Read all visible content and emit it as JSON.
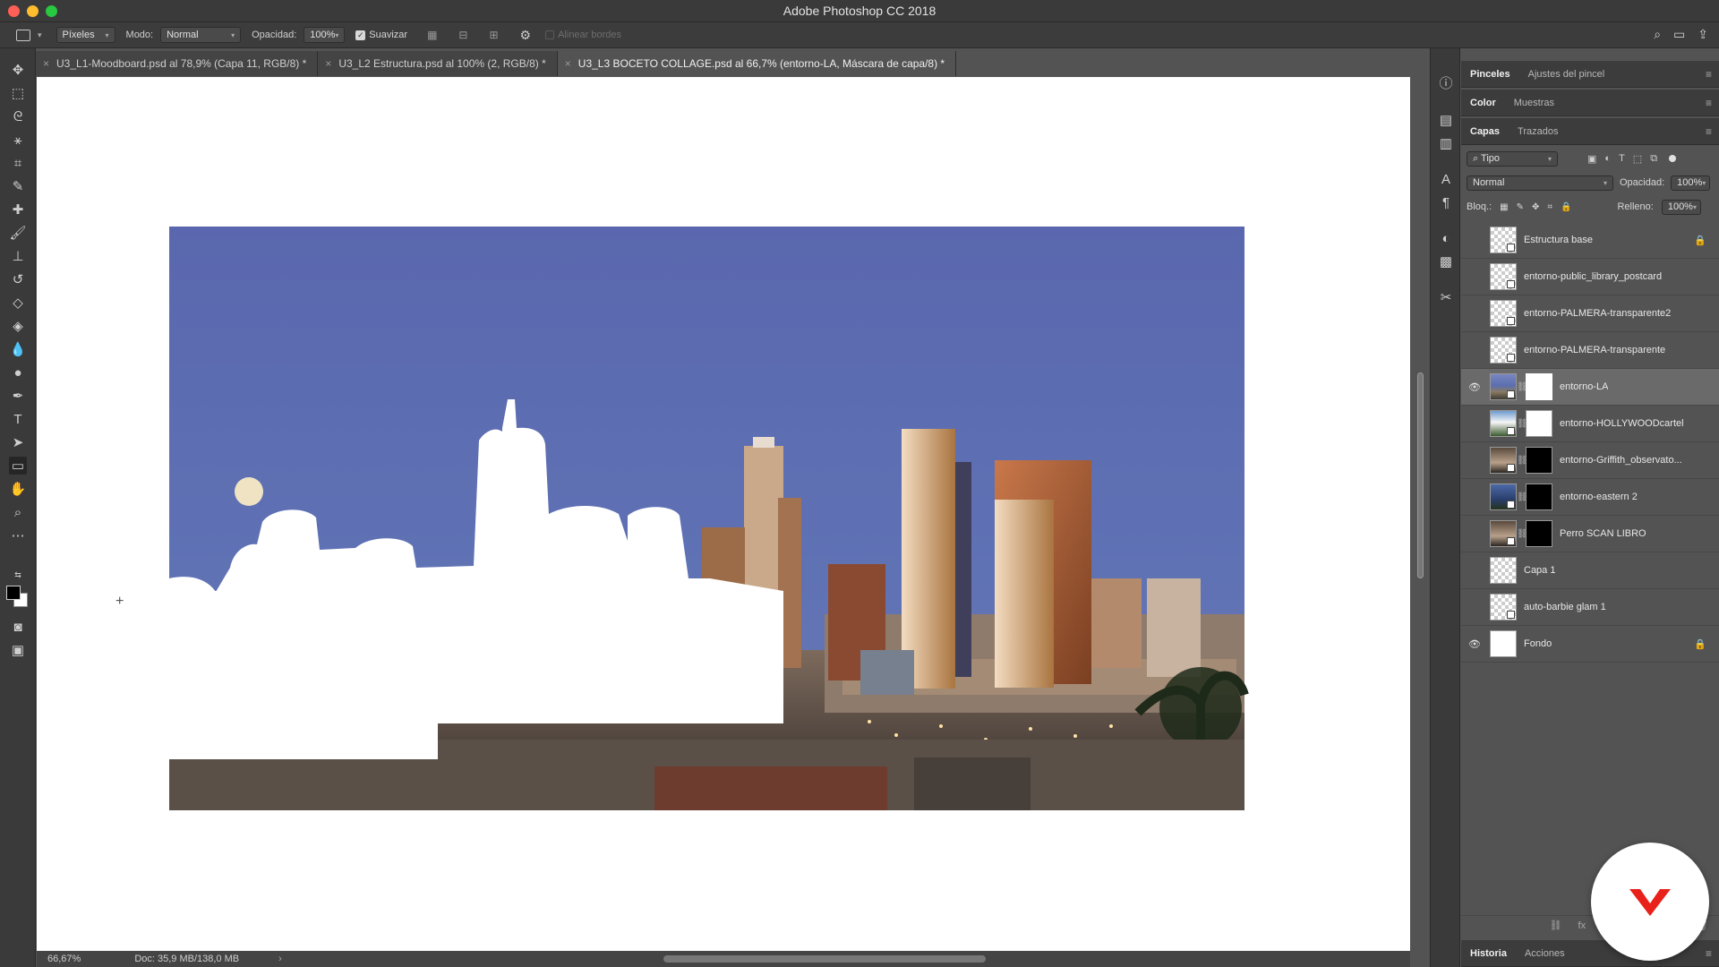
{
  "window": {
    "title": "Adobe Photoshop CC 2018"
  },
  "options": {
    "mode_select": "Píxeles",
    "blend_label": "Modo:",
    "blend_value": "Normal",
    "opacity_label": "Opacidad:",
    "opacity_value": "100%",
    "smooth_label": "Suavizar",
    "align_edges_label": "Alinear bordes"
  },
  "tabs": [
    {
      "label": "U3_L1-Moodboard.psd al 78,9% (Capa 11, RGB/8) *",
      "active": false
    },
    {
      "label": "U3_L2 Estructura.psd al 100% (2, RGB/8) *",
      "active": false
    },
    {
      "label": "U3_L3 BOCETO COLLAGE.psd al 66,7% (entorno-LA, Máscara de capa/8) *",
      "active": true
    }
  ],
  "status": {
    "zoom": "66,67%",
    "doc": "Doc: 35,9 MB/138,0 MB"
  },
  "panels": {
    "top_tabs": [
      "Pinceles",
      "Ajustes del pincel"
    ],
    "color_tabs": [
      "Color",
      "Muestras"
    ],
    "layer_tabs": [
      "Capas",
      "Trazados"
    ],
    "history_tabs": [
      "Historia",
      "Acciones"
    ],
    "filter_type": "Tipo",
    "blend_mode": "Normal",
    "opacity_label": "Opacidad:",
    "opacity_value": "100%",
    "lock_label": "Bloq.:",
    "fill_label": "Relleno:",
    "fill_value": "100%"
  },
  "layers": [
    {
      "name": "Estructura base",
      "visible": false,
      "locked": true,
      "thumb": "checker",
      "mask": null,
      "selected": false
    },
    {
      "name": "entorno-public_library_postcard",
      "visible": false,
      "locked": false,
      "thumb": "checker",
      "mask": null,
      "selected": false
    },
    {
      "name": "entorno-PALMERA-transparente2",
      "visible": false,
      "locked": false,
      "thumb": "checker",
      "mask": null,
      "selected": false
    },
    {
      "name": "entorno-PALMERA-transparente",
      "visible": false,
      "locked": false,
      "thumb": "checker",
      "mask": null,
      "selected": false
    },
    {
      "name": "entorno-LA",
      "visible": true,
      "locked": false,
      "thumb": "photo",
      "mask": "white",
      "selected": true
    },
    {
      "name": "entorno-HOLLYWOODcartel",
      "visible": false,
      "locked": false,
      "thumb": "photo2",
      "mask": "white",
      "selected": false
    },
    {
      "name": "entorno-Griffith_observato...",
      "visible": false,
      "locked": false,
      "thumb": "photo4",
      "mask": "black",
      "selected": false
    },
    {
      "name": "entorno-eastern 2",
      "visible": false,
      "locked": false,
      "thumb": "photo3",
      "mask": "black",
      "selected": false
    },
    {
      "name": "Perro SCAN LIBRO",
      "visible": false,
      "locked": false,
      "thumb": "photo4",
      "mask": "black",
      "selected": false
    },
    {
      "name": "Capa 1",
      "visible": false,
      "locked": false,
      "thumb": "checker",
      "mask": null,
      "selected": false
    },
    {
      "name": "auto-barbie glam 1",
      "visible": false,
      "locked": false,
      "thumb": "checker",
      "mask": null,
      "selected": false
    },
    {
      "name": "Fondo",
      "visible": true,
      "locked": true,
      "thumb": "white",
      "mask": null,
      "selected": false
    }
  ],
  "colors": {
    "accent_logo": "#e8211a",
    "sky": "#5d6eb4"
  }
}
